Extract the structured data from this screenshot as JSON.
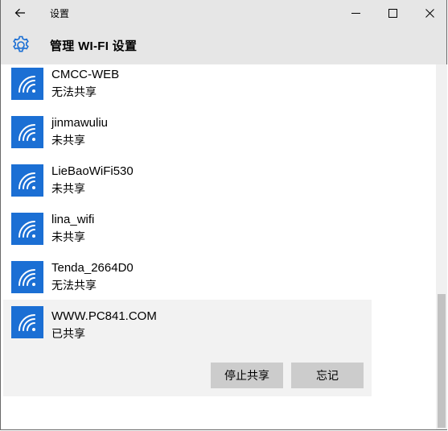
{
  "window": {
    "title": "设置"
  },
  "header": {
    "title": "管理 WI-FI 设置"
  },
  "networks": [
    {
      "ssid": "CMCC-WEB",
      "status": "无法共享"
    },
    {
      "ssid": "jinmawuliu",
      "status": "未共享"
    },
    {
      "ssid": "LieBaoWiFi530",
      "status": "未共享"
    },
    {
      "ssid": "lina_wifi",
      "status": "未共享"
    },
    {
      "ssid": "Tenda_2664D0",
      "status": "无法共享"
    },
    {
      "ssid": "WWW.PC841.COM",
      "status": "已共享"
    }
  ],
  "actions": {
    "stop_sharing": "停止共享",
    "forget": "忘记"
  },
  "colors": {
    "accent": "#1b6fd4",
    "chrome": "#e6e6e6",
    "selected_bg": "#f2f2f2",
    "button_bg": "#cccccc"
  },
  "icons": {
    "back": "back-arrow-icon",
    "minimize": "minimize-icon",
    "maximize": "maximize-icon",
    "close": "close-icon",
    "settings": "gear-icon",
    "wifi": "wifi-icon"
  },
  "scroll": {
    "thumb_position": "bottom"
  }
}
